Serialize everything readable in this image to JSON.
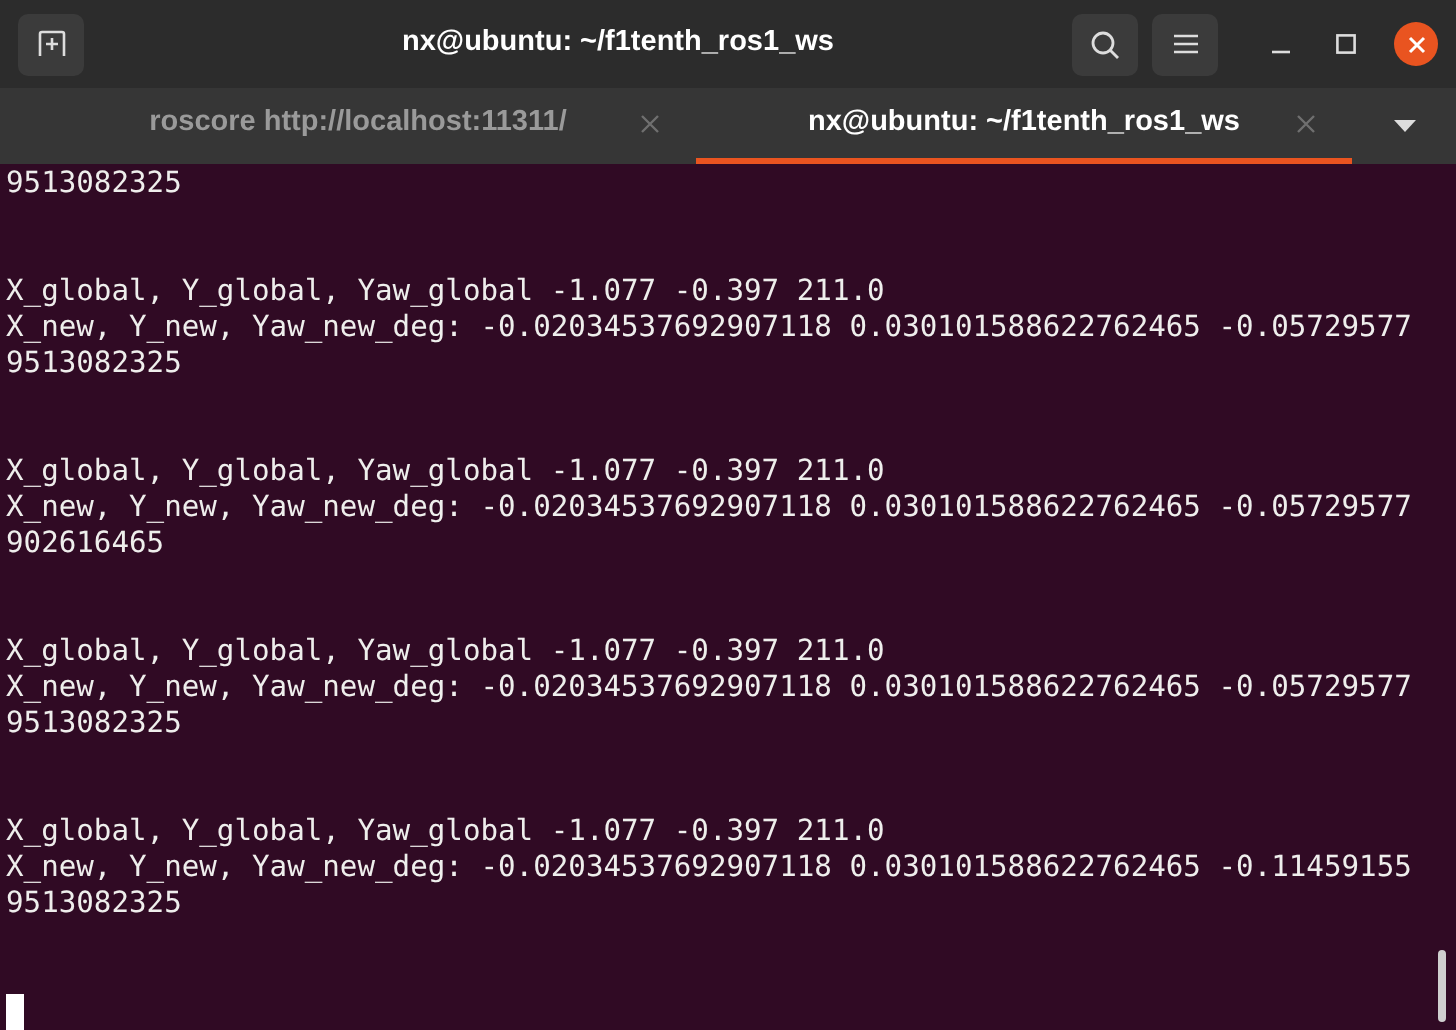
{
  "window": {
    "title": "nx@ubuntu: ~/f1tenth_ros1_ws"
  },
  "tabs": [
    {
      "label": "roscore http://localhost:11311/",
      "selected": false
    },
    {
      "label": "nx@ubuntu: ~/f1tenth_ros1_ws",
      "selected": true
    }
  ],
  "terminal": {
    "blocks": [
      {
        "lines": [
          "9513082325"
        ]
      },
      {
        "lines": [
          "X_global, Y_global, Yaw_global -1.077 -0.397 211.0",
          "X_new, Y_new, Yaw_new_deg: -0.02034537692907118 0.030101588622762465 -0.05729577",
          "9513082325"
        ]
      },
      {
        "lines": [
          "X_global, Y_global, Yaw_global -1.077 -0.397 211.0",
          "X_new, Y_new, Yaw_new_deg: -0.02034537692907118 0.030101588622762465 -0.05729577",
          "902616465"
        ]
      },
      {
        "lines": [
          "X_global, Y_global, Yaw_global -1.077 -0.397 211.0",
          "X_new, Y_new, Yaw_new_deg: -0.02034537692907118 0.030101588622762465 -0.05729577",
          "9513082325"
        ]
      },
      {
        "lines": [
          "X_global, Y_global, Yaw_global -1.077 -0.397 211.0",
          "X_new, Y_new, Yaw_new_deg: -0.02034537692907118 0.030101588622762465 -0.11459155",
          "9513082325"
        ]
      }
    ]
  }
}
